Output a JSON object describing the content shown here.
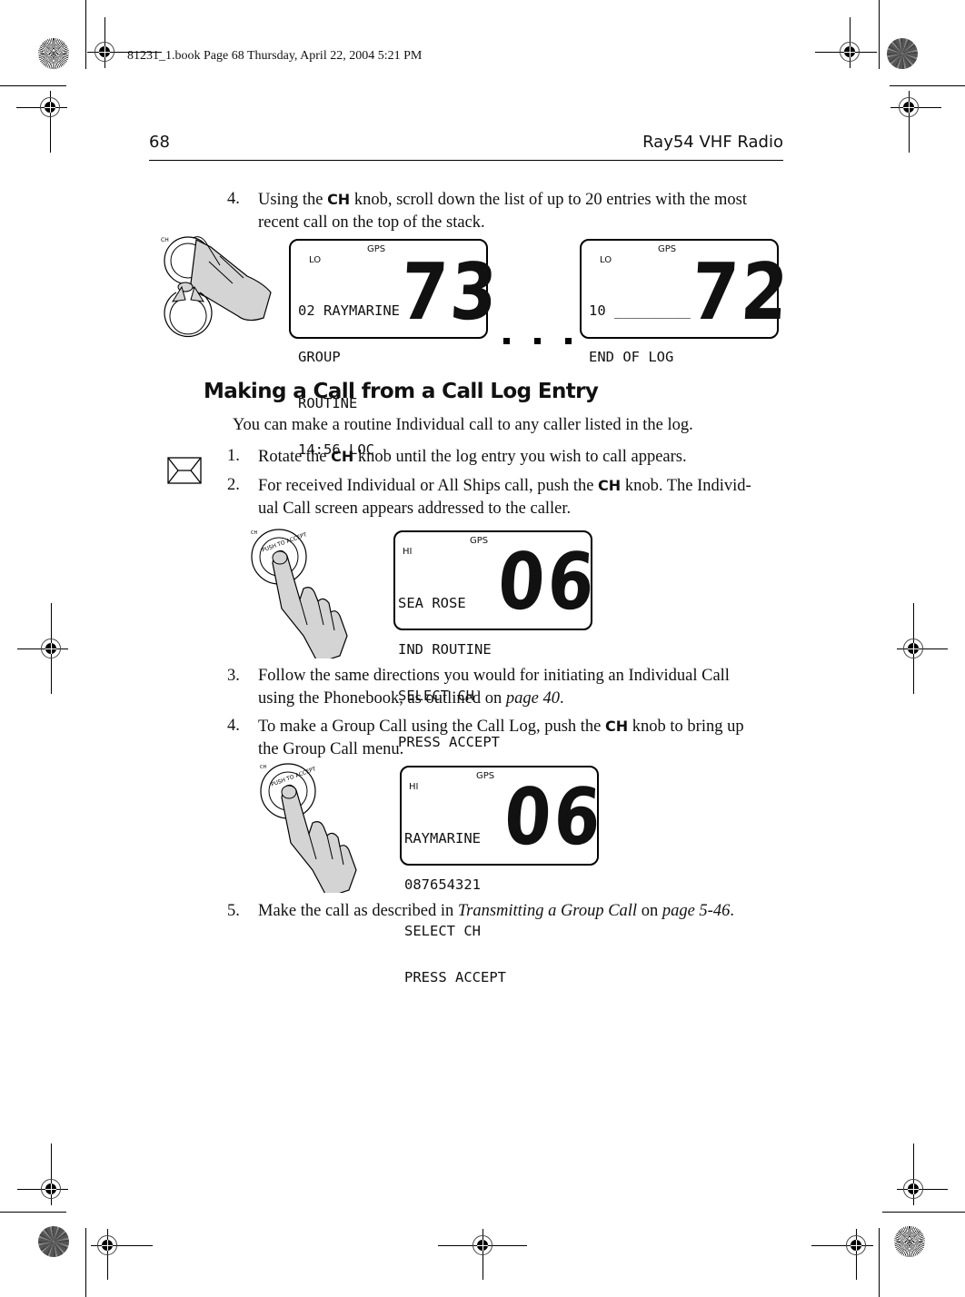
{
  "slug": "81231_1.book  Page 68  Thursday, April 22, 2004  5:21 PM",
  "header": {
    "page_number": "68",
    "title": "Ray54 VHF Radio"
  },
  "step4_top": {
    "number": "4.",
    "text_before": "Using the ",
    "key": "CH",
    "text_after": " knob, scroll down the list of up to 20 entries with the most",
    "line2": "recent call on the top of the stack."
  },
  "lcd_screens": [
    {
      "gps": "GPS",
      "power": "LO",
      "lines": [
        "02 RAYMARINE",
        "GROUP",
        "ROUTINE",
        "14:56 LOC"
      ],
      "channel": "73"
    },
    {
      "gps": "GPS",
      "power": "LO",
      "lines": [
        "10 _________",
        "END OF LOG"
      ],
      "channel": "72"
    },
    {
      "gps": "GPS",
      "power": "HI",
      "lines": [
        "SEA ROSE",
        "IND ROUTINE",
        "SELECT CH",
        "PRESS ACCEPT"
      ],
      "channel": "06"
    },
    {
      "gps": "GPS",
      "power": "HI",
      "lines": [
        "RAYMARINE",
        "087654321",
        "SELECT CH",
        "PRESS ACCEPT"
      ],
      "channel": "06"
    }
  ],
  "knob_labels": {
    "ch": "CH",
    "push_to_accept": "PUSH TO ACCEPT"
  },
  "section": {
    "title": "Making a Call from a Call Log Entry",
    "intro": "You can make a routine Individual call to any caller listed in the log."
  },
  "steps": [
    {
      "number": "1.",
      "text_before": "Rotate the ",
      "key": "CH",
      "text_after": " knob until the log entry you wish to call appears."
    },
    {
      "number": "2.",
      "text_before": "For received Individual or All Ships call, push the ",
      "key": "CH",
      "text_after": " knob. The Individ-",
      "line2": "ual Call screen appears addressed to the caller."
    },
    {
      "number": "3.",
      "line1": "Follow the same directions you would for initiating an Individual Call",
      "line2_before": "using the Phonebook, as outlined on ",
      "line2_link": "page 40",
      "line2_after": "."
    },
    {
      "number": "4.",
      "text_before": "To make a Group Call using the Call Log, push the ",
      "key": "CH",
      "text_after": " knob to bring up",
      "line2": "the Group Call menu."
    },
    {
      "number": "5.",
      "text_before": "Make the call as described in ",
      "link_title": "Transmitting a Group Call",
      "text_mid": " on ",
      "link_page": "page 5-46",
      "text_after": "."
    }
  ],
  "icons": {
    "note": "envelope-icon",
    "rotate": "rotate-arrows-icon",
    "hand": "hand-pressing-knob-icon"
  }
}
